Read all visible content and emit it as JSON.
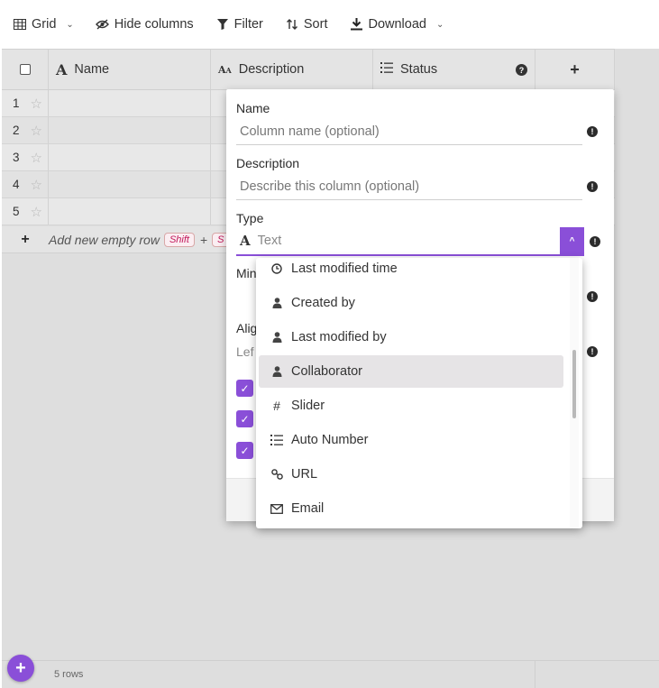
{
  "toolbar": {
    "grid_label": "Grid",
    "hide_columns_label": "Hide columns",
    "filter_label": "Filter",
    "sort_label": "Sort",
    "download_label": "Download"
  },
  "header": {
    "name_label": "Name",
    "description_label": "Description",
    "status_label": "Status",
    "add_column": "+"
  },
  "rows": [
    {
      "num": "1"
    },
    {
      "num": "2"
    },
    {
      "num": "3"
    },
    {
      "num": "4"
    },
    {
      "num": "5"
    }
  ],
  "add_row": {
    "label": "Add new empty row",
    "key1": "Shift",
    "plus": "+",
    "key2_partial": "S"
  },
  "footer": {
    "row_count": "5 rows"
  },
  "panel": {
    "name_label": "Name",
    "name_placeholder": "Column name (optional)",
    "description_label": "Description",
    "description_placeholder": "Describe this column (optional)",
    "type_label": "Type",
    "type_value": "Text",
    "min_label_partial": "Min",
    "align_label_partial": "Alig",
    "align_value_partial": "Lef"
  },
  "dropdown": {
    "items": [
      {
        "label": "Last modified time",
        "icon": "clock-icon"
      },
      {
        "label": "Created by",
        "icon": "person-icon"
      },
      {
        "label": "Last modified by",
        "icon": "person-icon"
      },
      {
        "label": "Collaborator",
        "icon": "person-icon"
      },
      {
        "label": "Slider",
        "icon": "hash-icon"
      },
      {
        "label": "Auto Number",
        "icon": "numbered-list-icon"
      },
      {
        "label": "URL",
        "icon": "link-icon"
      },
      {
        "label": "Email",
        "icon": "envelope-icon"
      }
    ],
    "selected": "Collaborator"
  },
  "colors": {
    "accent": "#8a4fd8",
    "kbd_text": "#c2185b"
  }
}
